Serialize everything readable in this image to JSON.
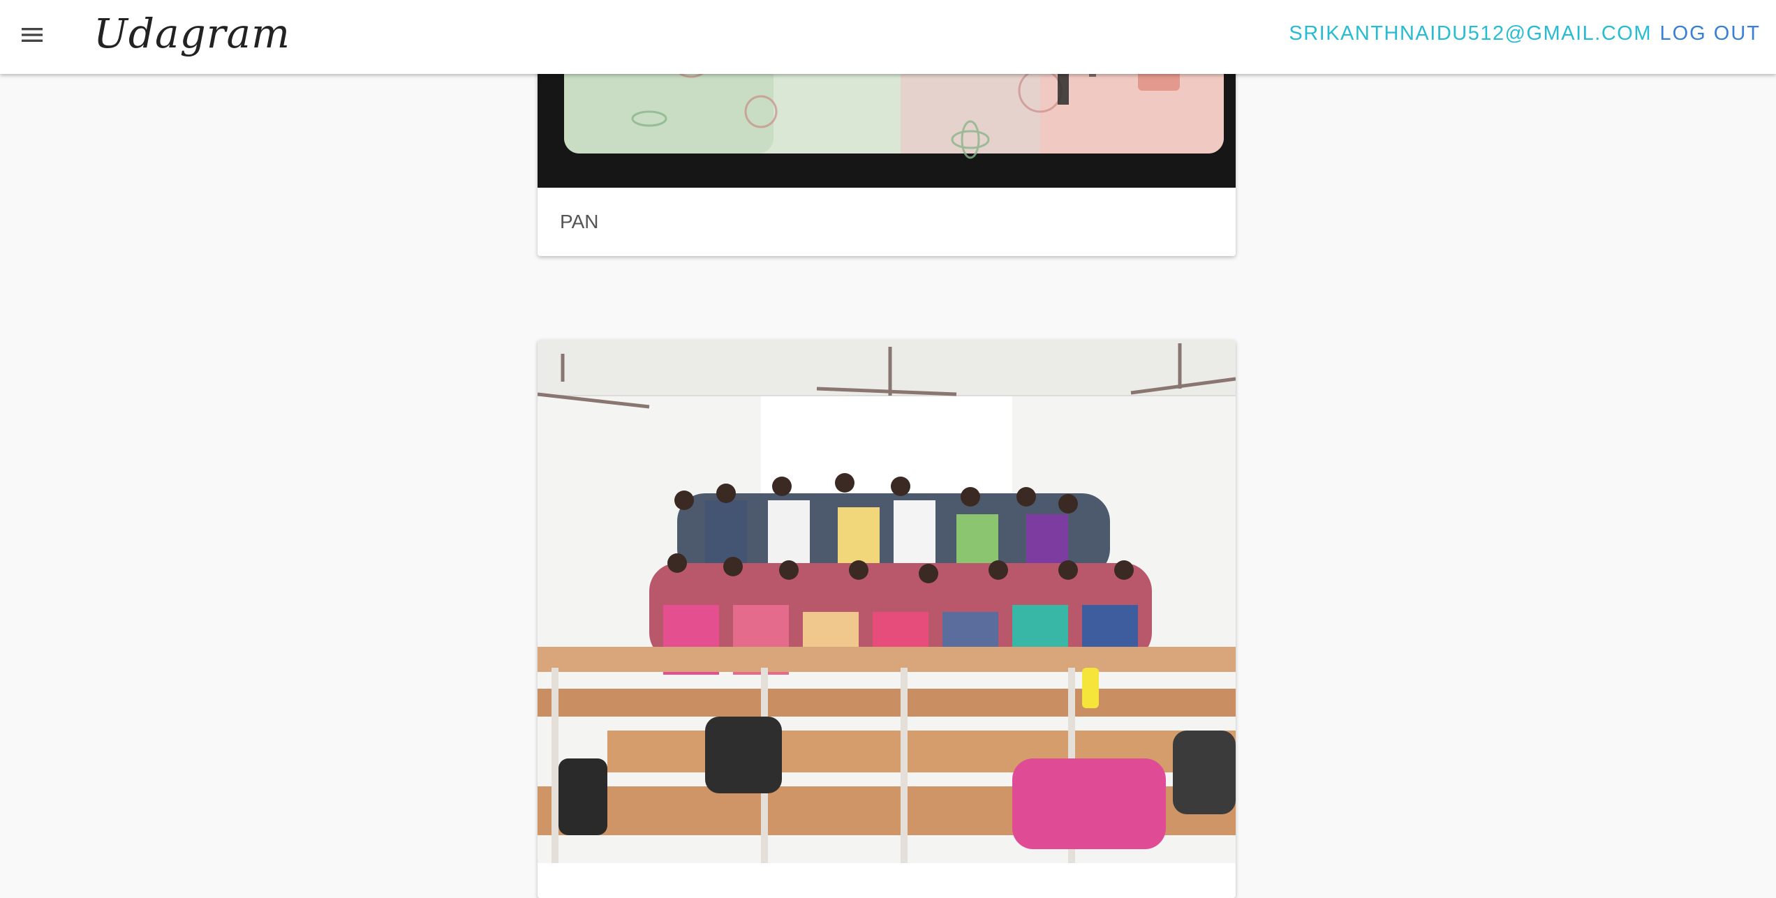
{
  "app": {
    "brand": "Udagram"
  },
  "nav": {
    "menu_icon": "hamburger-menu-icon",
    "user_email": "SRIKANTHNAIDU512@GMAIL.COM",
    "logout_label": "LOG OUT"
  },
  "colors": {
    "email_link": "#26bcd4",
    "logout_link": "#3880d6",
    "background": "#f9f9f9"
  },
  "feed": {
    "items": [
      {
        "caption": "PAN"
      },
      {
        "caption": ""
      }
    ]
  }
}
